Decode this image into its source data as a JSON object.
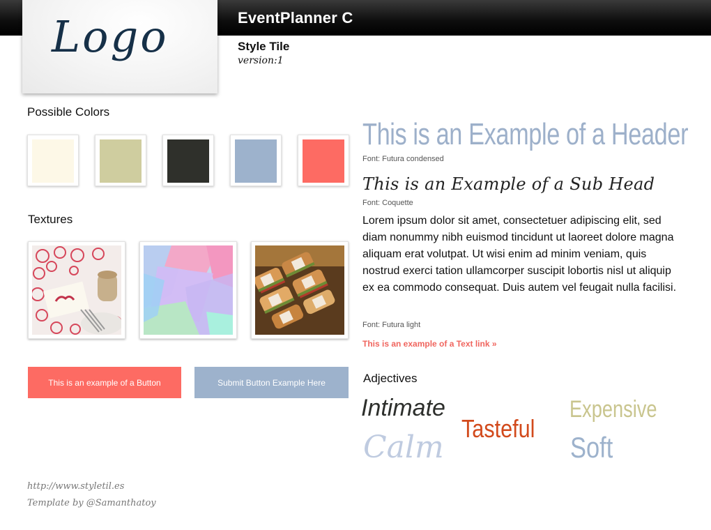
{
  "header": {
    "app_title": "EventPlanner C",
    "logo_text": "Logo",
    "style_tile_label": "Style Tile",
    "version_label": "version:1"
  },
  "colors": {
    "title": "Possible Colors",
    "swatches": [
      "#fdf8e7",
      "#cfcd9f",
      "#2f302b",
      "#9db2cc",
      "#fd6b63"
    ]
  },
  "textures": {
    "title": "Textures",
    "items": [
      "place-card-texture",
      "pastel-shapes-texture",
      "sandwiches-texture"
    ]
  },
  "buttons": {
    "primary_label": "This is an example of a Button",
    "submit_label": "Submit Button Example Here",
    "primary_color": "#fd6b63",
    "submit_color": "#9db2cc"
  },
  "typography": {
    "header_example": "This is an Example of a Header",
    "header_font": "Font: Futura condensed",
    "subhead_example": "This is an Example of a Sub Head",
    "subhead_font": "Font: Coquette",
    "body_text": "Lorem ipsum dolor sit amet, consectetuer adipiscing elit, sed diam nonummy nibh euismod tincidunt ut laoreet dolore magna aliquam erat volutpat. Ut wisi enim ad minim veniam, quis nostrud exerci tation ullamcorper suscipit lobortis nisl ut aliquip ex ea commodo consequat. Duis autem vel feugait nulla facilisi.",
    "body_font": "Font: Futura light",
    "text_link": "This is an example of a Text link »"
  },
  "adjectives": {
    "title": "Adjectives",
    "words": [
      "Intimate",
      "Tasteful",
      "Expensive",
      "Calm",
      "Soft"
    ]
  },
  "footer": {
    "url": "http://www.styletil.es",
    "credit": "Template by @Samanthatoy"
  }
}
